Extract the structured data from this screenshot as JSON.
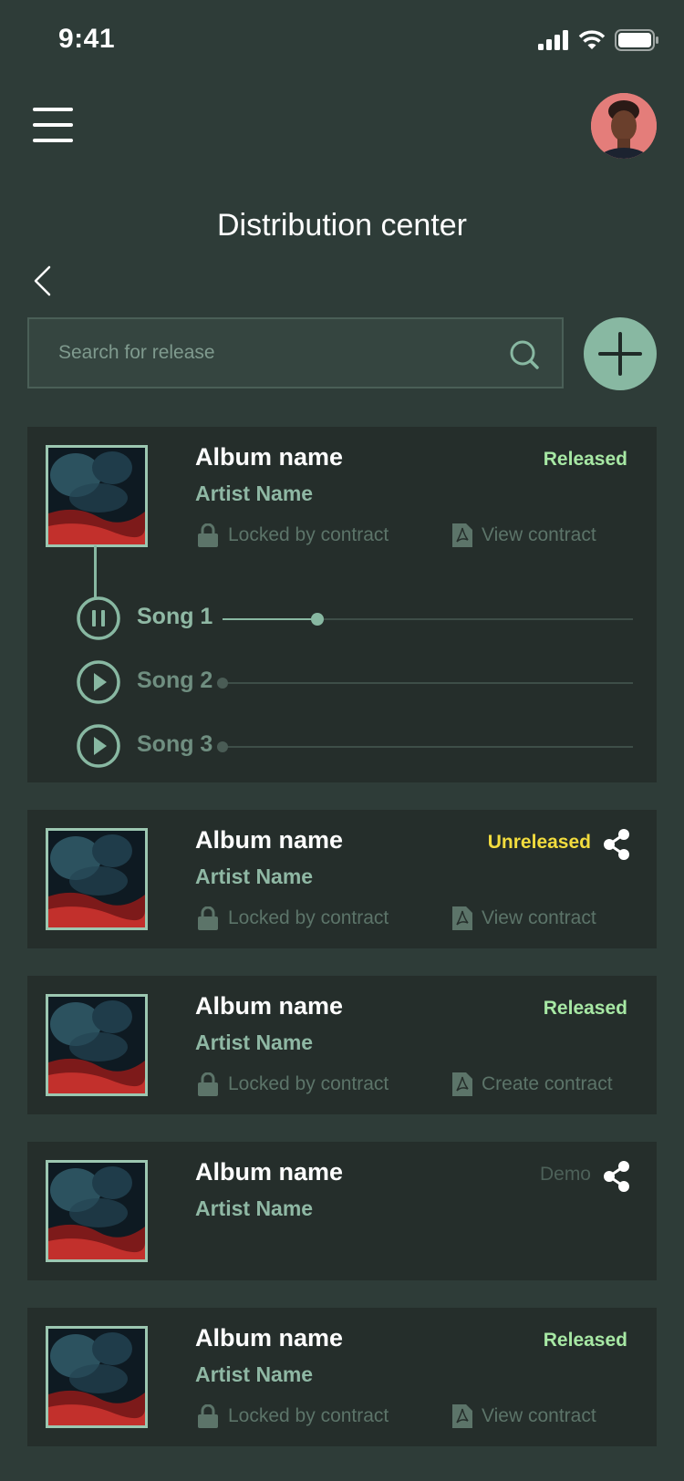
{
  "status_bar": {
    "time": "9:41"
  },
  "header": {
    "title": "Distribution center"
  },
  "search": {
    "placeholder": "Search for release"
  },
  "colors": {
    "released": "#a7e8a4",
    "unreleased": "#f2dc3e",
    "demo": "#4d6159",
    "accent": "#88b8a2"
  },
  "releases": [
    {
      "album": "Album name",
      "artist": "Artist Name",
      "status": "Released",
      "lock_label": "Locked by contract",
      "contract_label": "View contract",
      "songs": [
        {
          "title": "Song 1",
          "state": "playing",
          "progress": 0.23
        },
        {
          "title": "Song 2",
          "state": "paused",
          "progress": 0
        },
        {
          "title": "Song 3",
          "state": "paused",
          "progress": 0
        }
      ]
    },
    {
      "album": "Album name",
      "artist": "Artist Name",
      "status": "Unreleased",
      "lock_label": "Locked by contract",
      "contract_label": "View contract"
    },
    {
      "album": "Album name",
      "artist": "Artist Name",
      "status": "Released",
      "lock_label": "Locked by contract",
      "contract_label": "Create contract"
    },
    {
      "album": "Album name",
      "artist": "Artist Name",
      "status": "Demo"
    },
    {
      "album": "Album name",
      "artist": "Artist Name",
      "status": "Released",
      "lock_label": "Locked by contract",
      "contract_label": "View contract"
    }
  ]
}
